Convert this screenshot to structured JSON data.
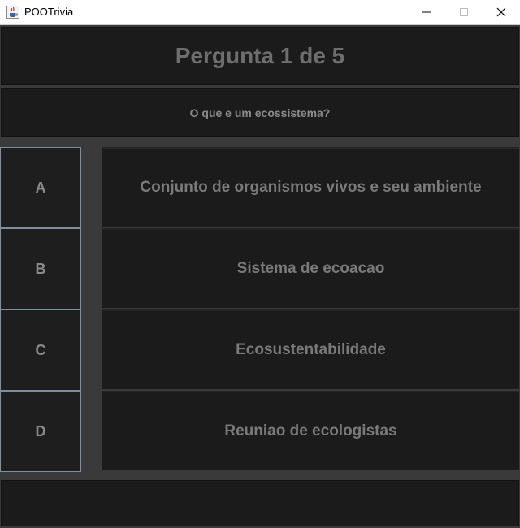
{
  "window": {
    "title": "POOTrivia",
    "icon": "java-coffee-icon"
  },
  "header": {
    "title": "Pergunta 1 de 5"
  },
  "question": {
    "text": "O que e um ecossistema?"
  },
  "options": [
    {
      "letter": "A",
      "text": "Conjunto de organismos vivos e seu ambiente"
    },
    {
      "letter": "B",
      "text": "Sistema de ecoacao"
    },
    {
      "letter": "C",
      "text": "Ecosustentabilidade"
    },
    {
      "letter": "D",
      "text": "Reuniao de ecologistas"
    }
  ],
  "footer": {
    "text": ""
  },
  "colors": {
    "background": "#3a3a3a",
    "panel": "#1b1b1b",
    "letter_border": "#7d8fa3",
    "text": "#7a7a7a"
  }
}
